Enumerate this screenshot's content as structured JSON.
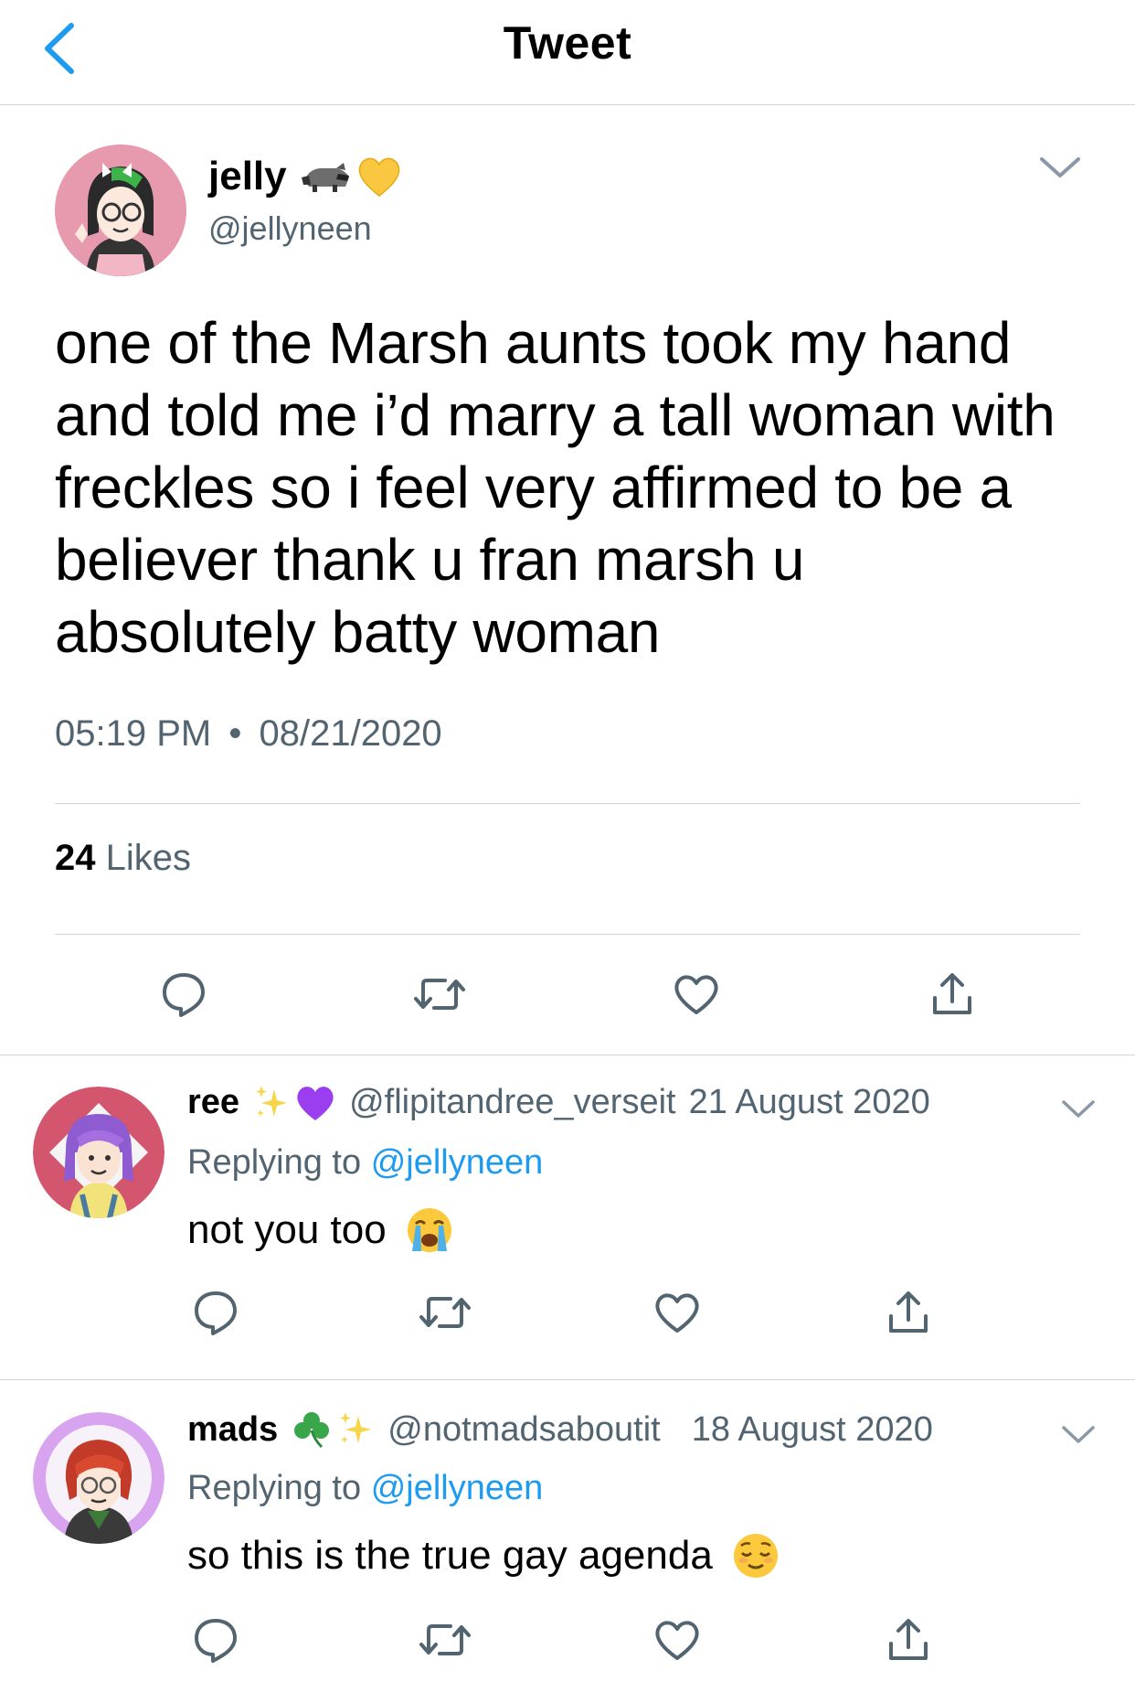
{
  "nav": {
    "title": "Tweet"
  },
  "tweet": {
    "author_name": "jelly",
    "author_emojis": [
      "raccoon-icon",
      "yellow-heart-icon"
    ],
    "author_handle": "@jellyneen",
    "text": "one of the Marsh aunts took my hand and told me i’d marry a tall woman with freckles so i feel very affirmed to be a believer thank u fran marsh u absolutely batty woman",
    "time": "05:19 PM",
    "separator": "•",
    "date": "08/21/2020",
    "likes_count": "24",
    "likes_label": "Likes"
  },
  "replies": [
    {
      "name": "ree",
      "emojis": [
        "sparkles-icon",
        "purple-heart-icon"
      ],
      "handle": "@flipitandree_verseit",
      "date": "21 August 2020",
      "replying_prefix": "Replying to",
      "replying_to": "@jellyneen",
      "text": "not you too",
      "text_emoji": "loudly-crying-face-icon"
    },
    {
      "name": "mads",
      "emojis": [
        "shamrock-icon",
        "sparkles-icon"
      ],
      "handle": "@notmadsaboutit",
      "date": "18 August 2020",
      "replying_prefix": "Replying to",
      "replying_to": "@jellyneen",
      "text": "so this is the true gay agenda",
      "text_emoji": "relieved-face-icon"
    }
  ],
  "colors": {
    "secondary_text": "#536471",
    "link": "#1d9bf0",
    "divider": "#cfd3d6",
    "back_arrow": "#1d9bf0"
  }
}
